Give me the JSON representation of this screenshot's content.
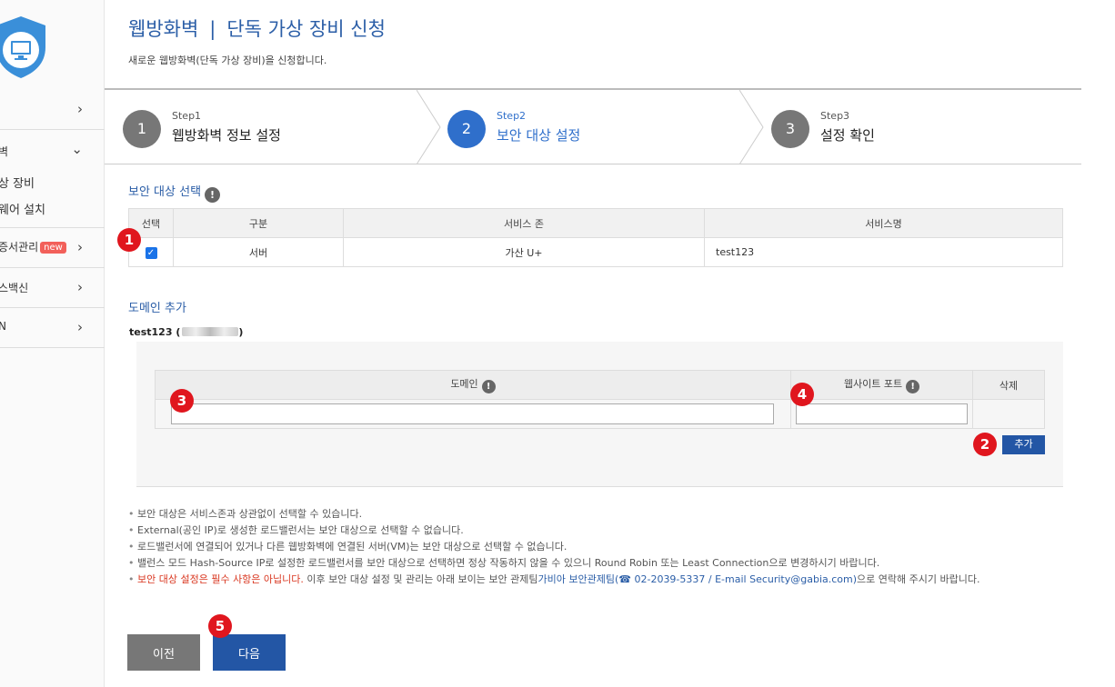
{
  "sidebar": {
    "items": [
      {
        "label": "",
        "chevron": "›"
      },
      {
        "label": "벽",
        "chevron": "⌄"
      },
      {
        "label": "증서관리",
        "badge": "new",
        "chevron": "›"
      },
      {
        "label": "스백신",
        "chevron": "›"
      },
      {
        "label": "N",
        "chevron": "›"
      }
    ],
    "subitems": [
      "상 장비",
      "웨어 설치"
    ]
  },
  "header": {
    "title_left": "웹방화벽",
    "title_sep": "|",
    "title_right": "단독 가상 장비 신청",
    "description": "새로운 웹방화벽(단독 가상 장비)을 신청합니다."
  },
  "steps": [
    {
      "num": "1",
      "small": "Step1",
      "label": "웹방화벽 정보 설정",
      "active": false
    },
    {
      "num": "2",
      "small": "Step2",
      "label": "보안 대상 설정",
      "active": true
    },
    {
      "num": "3",
      "small": "Step3",
      "label": "설정 확인",
      "active": false
    }
  ],
  "target_section": {
    "title": "보안 대상 선택",
    "headers": [
      "선택",
      "구분",
      "서비스 존",
      "서비스명"
    ],
    "row": {
      "type": "서버",
      "zone": "가산 U+",
      "name": "test123",
      "checked": true
    }
  },
  "domain_section": {
    "title": "도메인 추가",
    "server_name": "test123 (",
    "server_suffix": ")",
    "headers": {
      "domain": "도메인",
      "port": "웹사이트 포트",
      "delete": "삭제"
    },
    "domain_value": "",
    "port_value": "",
    "add_label": "추가"
  },
  "markers": [
    "1",
    "2",
    "3",
    "4",
    "5"
  ],
  "notes": [
    "보안 대상은 서비스존과 상관없이 선택할 수 있습니다.",
    "External(공인 IP)로 생성한 로드밸런서는 보안 대상으로 선택할 수 없습니다.",
    "로드밸런서에 연결되어 있거나 다른 웹방화벽에 연결된 서버(VM)는 보안 대상으로 선택할 수 없습니다.",
    "밸런스 모드 Hash-Source IP로 설정한 로드밸런서를 보안 대상으로 선택하면 정상 작동하지 않을 수 있으니 Round Robin 또는 Least Connection으로 변경하시기 바랍니다."
  ],
  "note_last": {
    "red": "보안 대상 설정은 필수 사항은 아닙니다.",
    "mid": " 이후 보안 대상 설정 및 관리는 아래 보이는 보안 관제팀",
    "blue": "가비아 보안관제팀",
    "contact": "(☎ 02-2039-5337 / E-mail Security@gabia.com)",
    "tail": "으로 연락해 주시기 바랍니다."
  },
  "buttons": {
    "prev": "이전",
    "next": "다음"
  },
  "colors": {
    "accent": "#2f6fcb",
    "title": "#2b5ea7",
    "button": "#2356a5",
    "marker": "#e0161e",
    "warning": "#d9361f"
  }
}
